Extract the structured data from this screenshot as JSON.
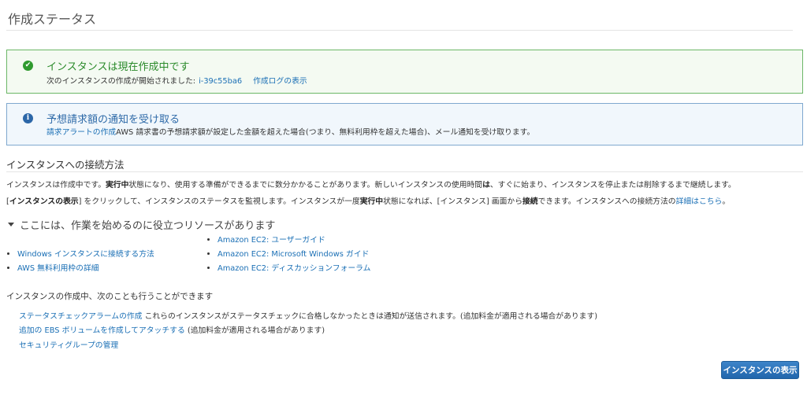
{
  "page": {
    "title": "作成ステータス"
  },
  "alerts": {
    "success": {
      "heading": "インスタンスは現在作成中です",
      "body_prefix": "次のインスタンスの作成が開始されました:",
      "instance_id": "i-39c55ba6",
      "log_link": "作成ログの表示",
      "color": "#2a8a2a"
    },
    "info": {
      "heading": "予想請求額の通知を受け取る",
      "link": "請求アラートの作成",
      "body": "AWS 請求書の予想請求額が設定した金額を超えた場合(つまり、無料利用枠を超えた場合)、メール通知を受け取ります。",
      "color": "#2e6aa8"
    }
  },
  "connect": {
    "heading": "インスタンスへの接続方法",
    "para1": {
      "t1": "インスタンスは作成中です。",
      "b1": "実行中",
      "t2": "状態になり、使用する準備ができるまでに数分かかることがあります。新しいインスタンスの使用時間",
      "b2": "は",
      "t3": "、すぐに始まり、インスタンスを停止または削除するまで継続します。"
    },
    "para2": {
      "t0": "[",
      "b1": "インスタンスの表示",
      "t1": "] をクリックして、インスタンスのステータスを監視します。インスタンスが一度",
      "b2": "実行中",
      "t2": "状態になれば、[インスタンス] 画面から",
      "b3": "接続",
      "t3": "できます。インスタンスへの接続方法の",
      "link": "詳細はこちら",
      "t4": "。"
    }
  },
  "resources": {
    "toggle_label": "ここには、作業を始めるのに役立つリソースがあります",
    "left": [
      "Windows インスタンスに接続する方法",
      "AWS 無料利用枠の詳細"
    ],
    "right": [
      "Amazon EC2: ユーザーガイド",
      "Amazon EC2: Microsoft Windows ガイド",
      "Amazon EC2: ディスカッションフォーラム"
    ]
  },
  "meanwhile": {
    "heading": "インスタンスの作成中、次のことも行うことができます",
    "actions": [
      {
        "link": "ステータスチェックアラームの作成",
        "note": "これらのインスタンスがステータスチェックに合格しなかったときは通知が送信されます。(追加料金が適用される場合があります)"
      },
      {
        "link": "追加の EBS ボリュームを作成してアタッチする",
        "note": "(追加料金が適用される場合があります)"
      },
      {
        "link": "セキュリティグループの管理",
        "note": ""
      }
    ]
  },
  "footer": {
    "view_instances_button": "インスタンスの表示"
  },
  "colors": {
    "link": "#1a6fb5",
    "primary": "#2166ac",
    "success_border": "#6cb767",
    "info_border": "#7fa8cf"
  }
}
